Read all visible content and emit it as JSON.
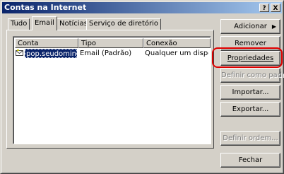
{
  "window": {
    "title": "Contas na Internet",
    "help_label": "?",
    "close_label": "X"
  },
  "tabs": [
    {
      "label": "Tudo"
    },
    {
      "label": "Email"
    },
    {
      "label": "Notícias"
    },
    {
      "label": "Serviço de diretório"
    }
  ],
  "list": {
    "columns": [
      "Conta",
      "Tipo",
      "Conexão"
    ],
    "rows": [
      {
        "conta": "pop.seudominio....",
        "tipo": "Email (Padrão)",
        "conexao": "Qualquer um dispo..."
      }
    ]
  },
  "buttons": {
    "adicionar": "Adicionar",
    "adicionar_arrow": "▶",
    "remover": "Remover",
    "propriedades": "Propriedades",
    "definir_padrao": "Definir como padrão",
    "importar": "Importar...",
    "exportar": "Exportar...",
    "definir_ordem": "Definir ordem...",
    "fechar": "Fechar"
  },
  "colors": {
    "highlight": "#e00000",
    "selection": "#0a246a"
  }
}
